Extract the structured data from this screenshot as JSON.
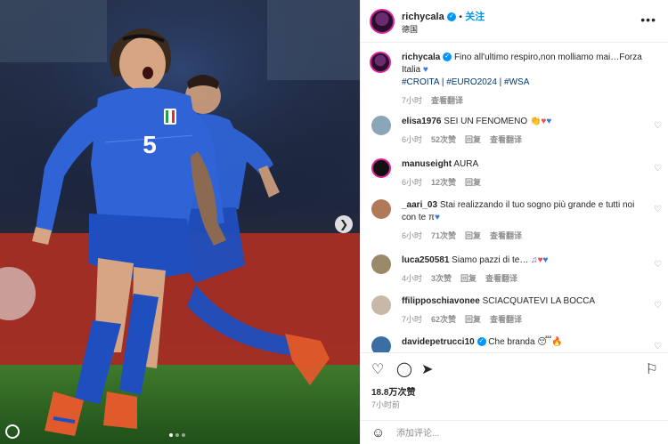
{
  "header": {
    "username": "richycala",
    "follow_label": "关注",
    "location": "德国",
    "dot": "•"
  },
  "caption": {
    "username": "richycala",
    "text": "Fino all'ultimo respiro,non molliamo mai…Forza Italia",
    "hashtags": "#CROITA | #EURO2024 | #WSA",
    "time": "7小时",
    "translate": "查看翻译"
  },
  "comments": [
    {
      "username": "elisa1976",
      "text": "SEI UN FENOMENO",
      "time": "6小时",
      "likes": "52次赞",
      "reply": "回复",
      "translate": "查看翻译"
    },
    {
      "username": "manuseight",
      "text": "AURA",
      "time": "6小时",
      "likes": "12次赞",
      "reply": "回复",
      "translate": ""
    },
    {
      "username": "_aari_03",
      "text": "Stai realizzando il tuo sogno più grande e tutti noi con te",
      "text2": "π",
      "time": "6小时",
      "likes": "71次赞",
      "reply": "回复",
      "translate": "查看翻译"
    },
    {
      "username": "luca250581",
      "text": "Siamo pazzi di te…",
      "time": "4小时",
      "likes": "3次赞",
      "reply": "回复",
      "translate": "查看翻译"
    },
    {
      "username": "ffilipposchiavonee",
      "text": "SCIACQUATEVI LA BOCCA",
      "time": "7小时",
      "likes": "62次赞",
      "reply": "回复",
      "translate": "查看翻译"
    },
    {
      "username": "davidepetrucci10",
      "text": "Che branda",
      "time": "",
      "likes": "",
      "reply": "",
      "translate": ""
    }
  ],
  "footer": {
    "likes": "18.8万次赞",
    "time": "7小时前",
    "comment_placeholder": "添加评论..."
  },
  "photo": {
    "jersey_number": "5"
  },
  "colors": {
    "accent": "#0095f6",
    "heart": "#ed4956",
    "italy_blue": "#1f4fbf"
  }
}
